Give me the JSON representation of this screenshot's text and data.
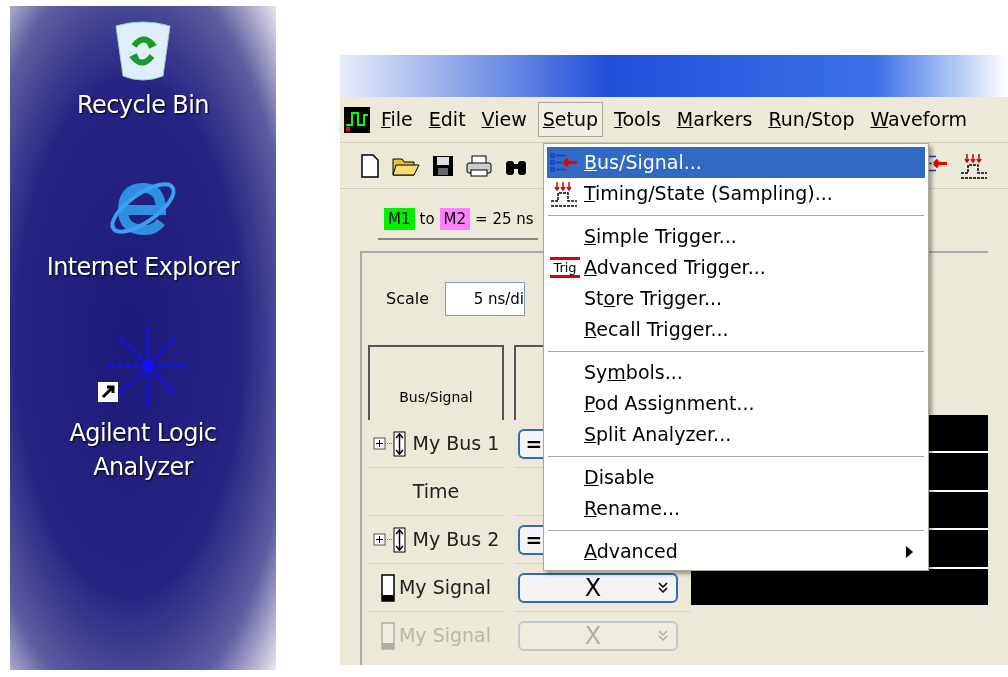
{
  "desktop": {
    "icons": [
      {
        "kind": "recycle",
        "label": "Recycle Bin"
      },
      {
        "kind": "browser",
        "label": "Internet Explorer"
      },
      {
        "kind": "analyzer",
        "label": "Agilent Logic Analyzer"
      }
    ]
  },
  "menubar": [
    {
      "key": "F",
      "post": "ile",
      "selected": false
    },
    {
      "key": "E",
      "post": "dit",
      "selected": false
    },
    {
      "key": "V",
      "post": "iew",
      "selected": false
    },
    {
      "key": "S",
      "post": "etup",
      "selected": true
    },
    {
      "key": "T",
      "post": "ools",
      "selected": false
    },
    {
      "key": "M",
      "post": "arkers",
      "selected": false
    },
    {
      "key": "R",
      "post": "un/Stop",
      "selected": false
    },
    {
      "key": "W",
      "post": "aveform",
      "selected": false
    }
  ],
  "markers": {
    "m1": "M1",
    "joiner": "to",
    "m2": "M2",
    "reading": "= 25 ns"
  },
  "scale": {
    "label": "Scale",
    "value": "5 ns/di"
  },
  "table": {
    "header": "Bus/Signal",
    "rows": [
      {
        "kind": "bus",
        "name": "My Bus 1",
        "value": "=",
        "faded": false
      },
      {
        "kind": "time",
        "name": "Time",
        "faded": false
      },
      {
        "kind": "bus",
        "name": "My Bus 2",
        "value": "=",
        "faded": false
      },
      {
        "kind": "signal",
        "name": "My Signal",
        "value": "X",
        "faded": false
      },
      {
        "kind": "signal",
        "name": "My Signal",
        "value": "X",
        "faded": true
      }
    ]
  },
  "setup_menu": [
    {
      "kind": "item",
      "key": "B",
      "post": "us/Signal...",
      "selected": true,
      "submenu": false
    },
    {
      "kind": "item",
      "key": "T",
      "post": "iming/State (Sampling)...",
      "selected": false,
      "submenu": false
    },
    {
      "kind": "separator"
    },
    {
      "kind": "item",
      "key": "S",
      "post": "imple Trigger...",
      "selected": false,
      "submenu": false
    },
    {
      "kind": "item",
      "icon_text": "Trig",
      "key": "A",
      "post": "dvanced Trigger...",
      "selected": false,
      "submenu": false
    },
    {
      "kind": "item",
      "pre": "St",
      "key": "o",
      "post": "re Trigger...",
      "selected": false,
      "submenu": false
    },
    {
      "kind": "item",
      "key": "R",
      "post": "ecall Trigger...",
      "selected": false,
      "submenu": false
    },
    {
      "kind": "separator"
    },
    {
      "kind": "item",
      "pre": "Sy",
      "key": "m",
      "post": "bols...",
      "selected": false,
      "submenu": false
    },
    {
      "kind": "item",
      "key": "P",
      "post": "od Assignment...",
      "selected": false,
      "submenu": false
    },
    {
      "kind": "item",
      "key": "S",
      "post": "plit Analyzer...",
      "selected": false,
      "submenu": false
    },
    {
      "kind": "separator"
    },
    {
      "kind": "item",
      "key": "D",
      "post": "isable",
      "selected": false,
      "submenu": false
    },
    {
      "kind": "item",
      "key": "R",
      "post": "ename...",
      "selected": false,
      "submenu": false
    },
    {
      "kind": "separator"
    },
    {
      "kind": "item",
      "key": "A",
      "post": "dvanced",
      "selected": false,
      "submenu": true
    }
  ]
}
